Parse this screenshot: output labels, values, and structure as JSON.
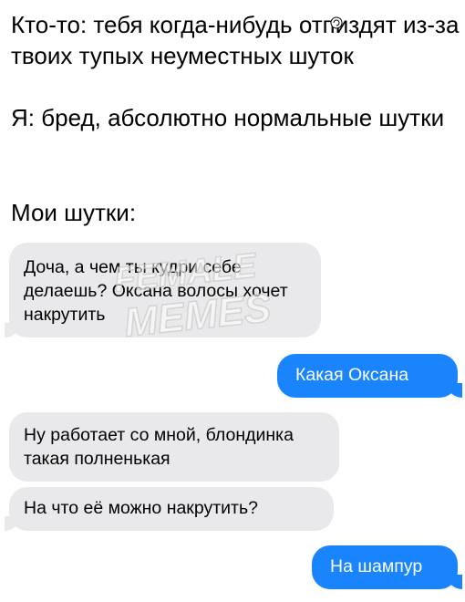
{
  "captions": {
    "line1": "Кто-то: тебя когда-нибудь отпиздят из-за твоих тупых неуместных шуток",
    "line2": "Я: бред, абсолютно нормальные шутки",
    "line3": "Мои шутки:"
  },
  "messages": [
    {
      "side": "incoming",
      "text": "Доча, а чем ты кудри себе делаешь? Оксана волосы хочет накрутить"
    },
    {
      "side": "outgoing",
      "text": "Какая Оксана"
    },
    {
      "side": "incoming",
      "text": "Ну работает со мной, блондинка такая полненькая"
    },
    {
      "side": "incoming",
      "text": "На что её можно накрутить?"
    },
    {
      "side": "outgoing",
      "text": "На шампур"
    }
  ],
  "watermark": {
    "line1": "FEMALE",
    "line2": "MEMES"
  },
  "colors": {
    "outgoing_bubble": "#1a84fd",
    "incoming_bubble": "#e9e9eb",
    "watermark": "#ffffff"
  }
}
